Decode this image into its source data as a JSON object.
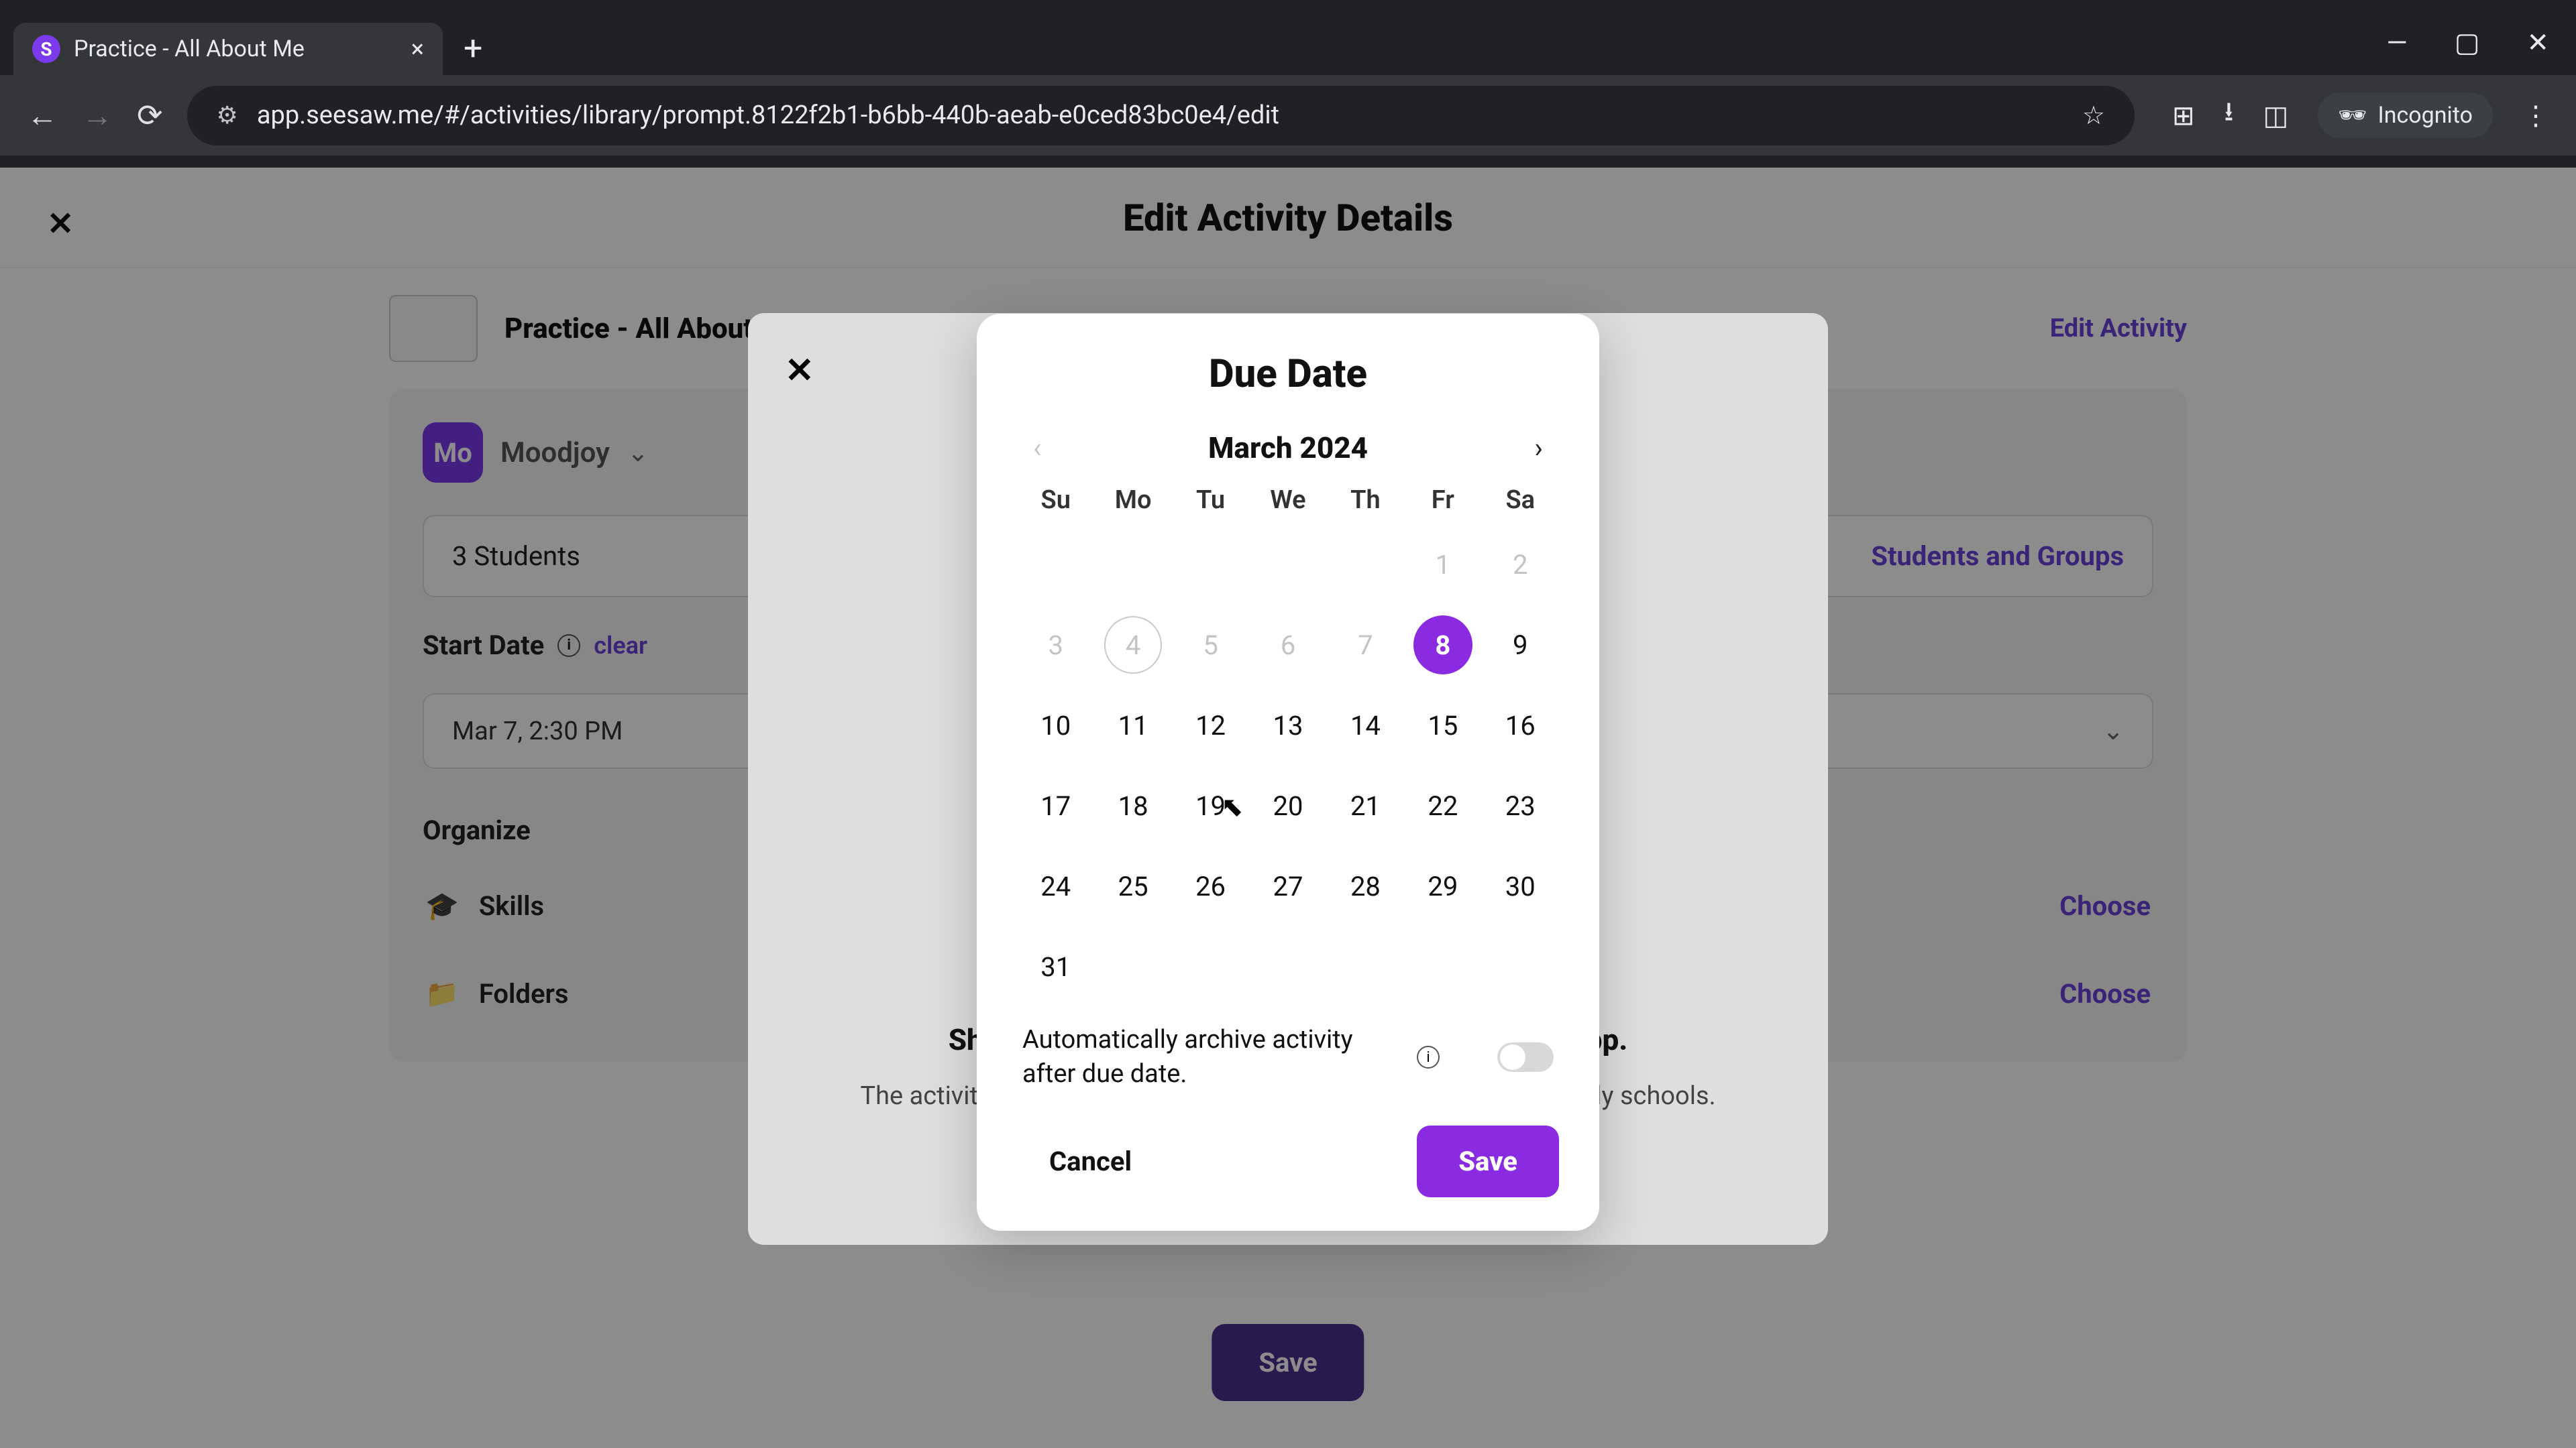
{
  "browser": {
    "tab_title": "Practice - All About Me",
    "favicon_letter": "S",
    "url": "app.seesaw.me/#/activities/library/prompt.8122f2b1-b6bb-440b-aeab-e0ced83bc0e4/edit",
    "incognito_label": "Incognito"
  },
  "page": {
    "header": "Edit Activity Details",
    "activity_title": "Practice - All About Me",
    "edit_activity": "Edit Activity",
    "class_avatar": "Mo",
    "class_name": "Moodjoy",
    "students_count": "3 Students",
    "students_link": "Students and Groups",
    "start_date_label": "Start Date",
    "clear_label": "clear",
    "start_date_value": "Mar 7, 2:30 PM",
    "organize_label": "Organize",
    "skills_label": "Skills",
    "folders_label": "Folders",
    "choose_label": "Choose",
    "save_label": "Save",
    "inner_hint1": "Share with students, teachers, and families on app.",
    "inner_hint2": "The activity will appear in the student app and on connected family schools."
  },
  "datepicker": {
    "title": "Due Date",
    "month_label": "March 2024",
    "weekdays": [
      "Su",
      "Mo",
      "Tu",
      "We",
      "Th",
      "Fr",
      "Sa"
    ],
    "weeks": [
      [
        {
          "n": "",
          "t": "blank"
        },
        {
          "n": "",
          "t": "blank"
        },
        {
          "n": "",
          "t": "blank"
        },
        {
          "n": "",
          "t": "blank"
        },
        {
          "n": "",
          "t": "blank"
        },
        {
          "n": "1",
          "t": "other"
        },
        {
          "n": "2",
          "t": "other"
        }
      ],
      [
        {
          "n": "3",
          "t": "other"
        },
        {
          "n": "4",
          "t": "today_other"
        },
        {
          "n": "5",
          "t": "other"
        },
        {
          "n": "6",
          "t": "other"
        },
        {
          "n": "7",
          "t": "other"
        },
        {
          "n": "8",
          "t": "selected"
        },
        {
          "n": "9",
          "t": "normal"
        }
      ],
      [
        {
          "n": "10",
          "t": "normal"
        },
        {
          "n": "11",
          "t": "normal"
        },
        {
          "n": "12",
          "t": "normal"
        },
        {
          "n": "13",
          "t": "normal"
        },
        {
          "n": "14",
          "t": "normal"
        },
        {
          "n": "15",
          "t": "normal"
        },
        {
          "n": "16",
          "t": "normal"
        }
      ],
      [
        {
          "n": "17",
          "t": "normal"
        },
        {
          "n": "18",
          "t": "normal"
        },
        {
          "n": "19",
          "t": "normal"
        },
        {
          "n": "20",
          "t": "normal"
        },
        {
          "n": "21",
          "t": "normal"
        },
        {
          "n": "22",
          "t": "normal"
        },
        {
          "n": "23",
          "t": "normal"
        }
      ],
      [
        {
          "n": "24",
          "t": "normal"
        },
        {
          "n": "25",
          "t": "normal"
        },
        {
          "n": "26",
          "t": "normal"
        },
        {
          "n": "27",
          "t": "normal"
        },
        {
          "n": "28",
          "t": "normal"
        },
        {
          "n": "29",
          "t": "normal"
        },
        {
          "n": "30",
          "t": "normal"
        }
      ],
      [
        {
          "n": "31",
          "t": "normal"
        },
        {
          "n": "",
          "t": "blank"
        },
        {
          "n": "",
          "t": "blank"
        },
        {
          "n": "",
          "t": "blank"
        },
        {
          "n": "",
          "t": "blank"
        },
        {
          "n": "",
          "t": "blank"
        },
        {
          "n": "",
          "t": "blank"
        }
      ]
    ],
    "archive_label": "Automatically archive activity after due date.",
    "cancel_label": "Cancel",
    "save_label": "Save"
  }
}
